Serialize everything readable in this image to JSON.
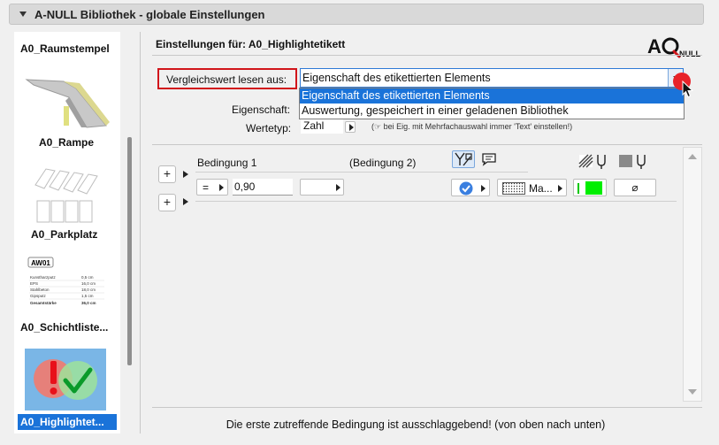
{
  "window": {
    "title": "A-NULL Bibliothek - globale Einstellungen"
  },
  "sidebar": {
    "items": [
      {
        "label": "A0_Raumstempel"
      },
      {
        "label": "A0_Rampe"
      },
      {
        "label": "A0_Parkplatz"
      },
      {
        "label": "A0_Schichtliste..."
      },
      {
        "label": "A0_Highlightet...",
        "selected": true
      }
    ],
    "schicht_thumb": {
      "code": "AW01",
      "rows": [
        [
          "Kunstharzputz",
          "0,5 cm"
        ],
        [
          "EPS",
          "16,0 cm"
        ],
        [
          "Stahlbeton",
          "18,0 cm"
        ],
        [
          "Gipsputz",
          "1,5 cm"
        ],
        [
          "Gesamtstärke",
          "36,0 cm"
        ]
      ]
    }
  },
  "settings": {
    "header": "Einstellungen für: A0_Highlightetikett",
    "logo": "A0NULL",
    "read_from_label": "Vergleichswert lesen aus:",
    "read_from_value": "Eigenschaft des etikettierten Elements",
    "dropdown_options": [
      "Eigenschaft des etikettierten Elements",
      "Auswertung, gespeichert in einer geladenen Bibliothek"
    ],
    "property_label": "Eigenschaft:",
    "value_type_label": "Wertetyp:",
    "value_type": "Zahl",
    "hint": "(☞ bei Eig. mit Mehrfachauswahl immer 'Text' einstellen!)"
  },
  "conditions": {
    "col1": "Bedingung 1",
    "col2": "(Bedingung 2)",
    "operator": "=",
    "value": "0,90",
    "material_label": "Ma...",
    "none_symbol": "⌀",
    "fill_color": "#00ee00"
  },
  "footer": {
    "text": "Die erste zutreffende Bedingung ist ausschlaggebend! (von oben nach unten)"
  }
}
